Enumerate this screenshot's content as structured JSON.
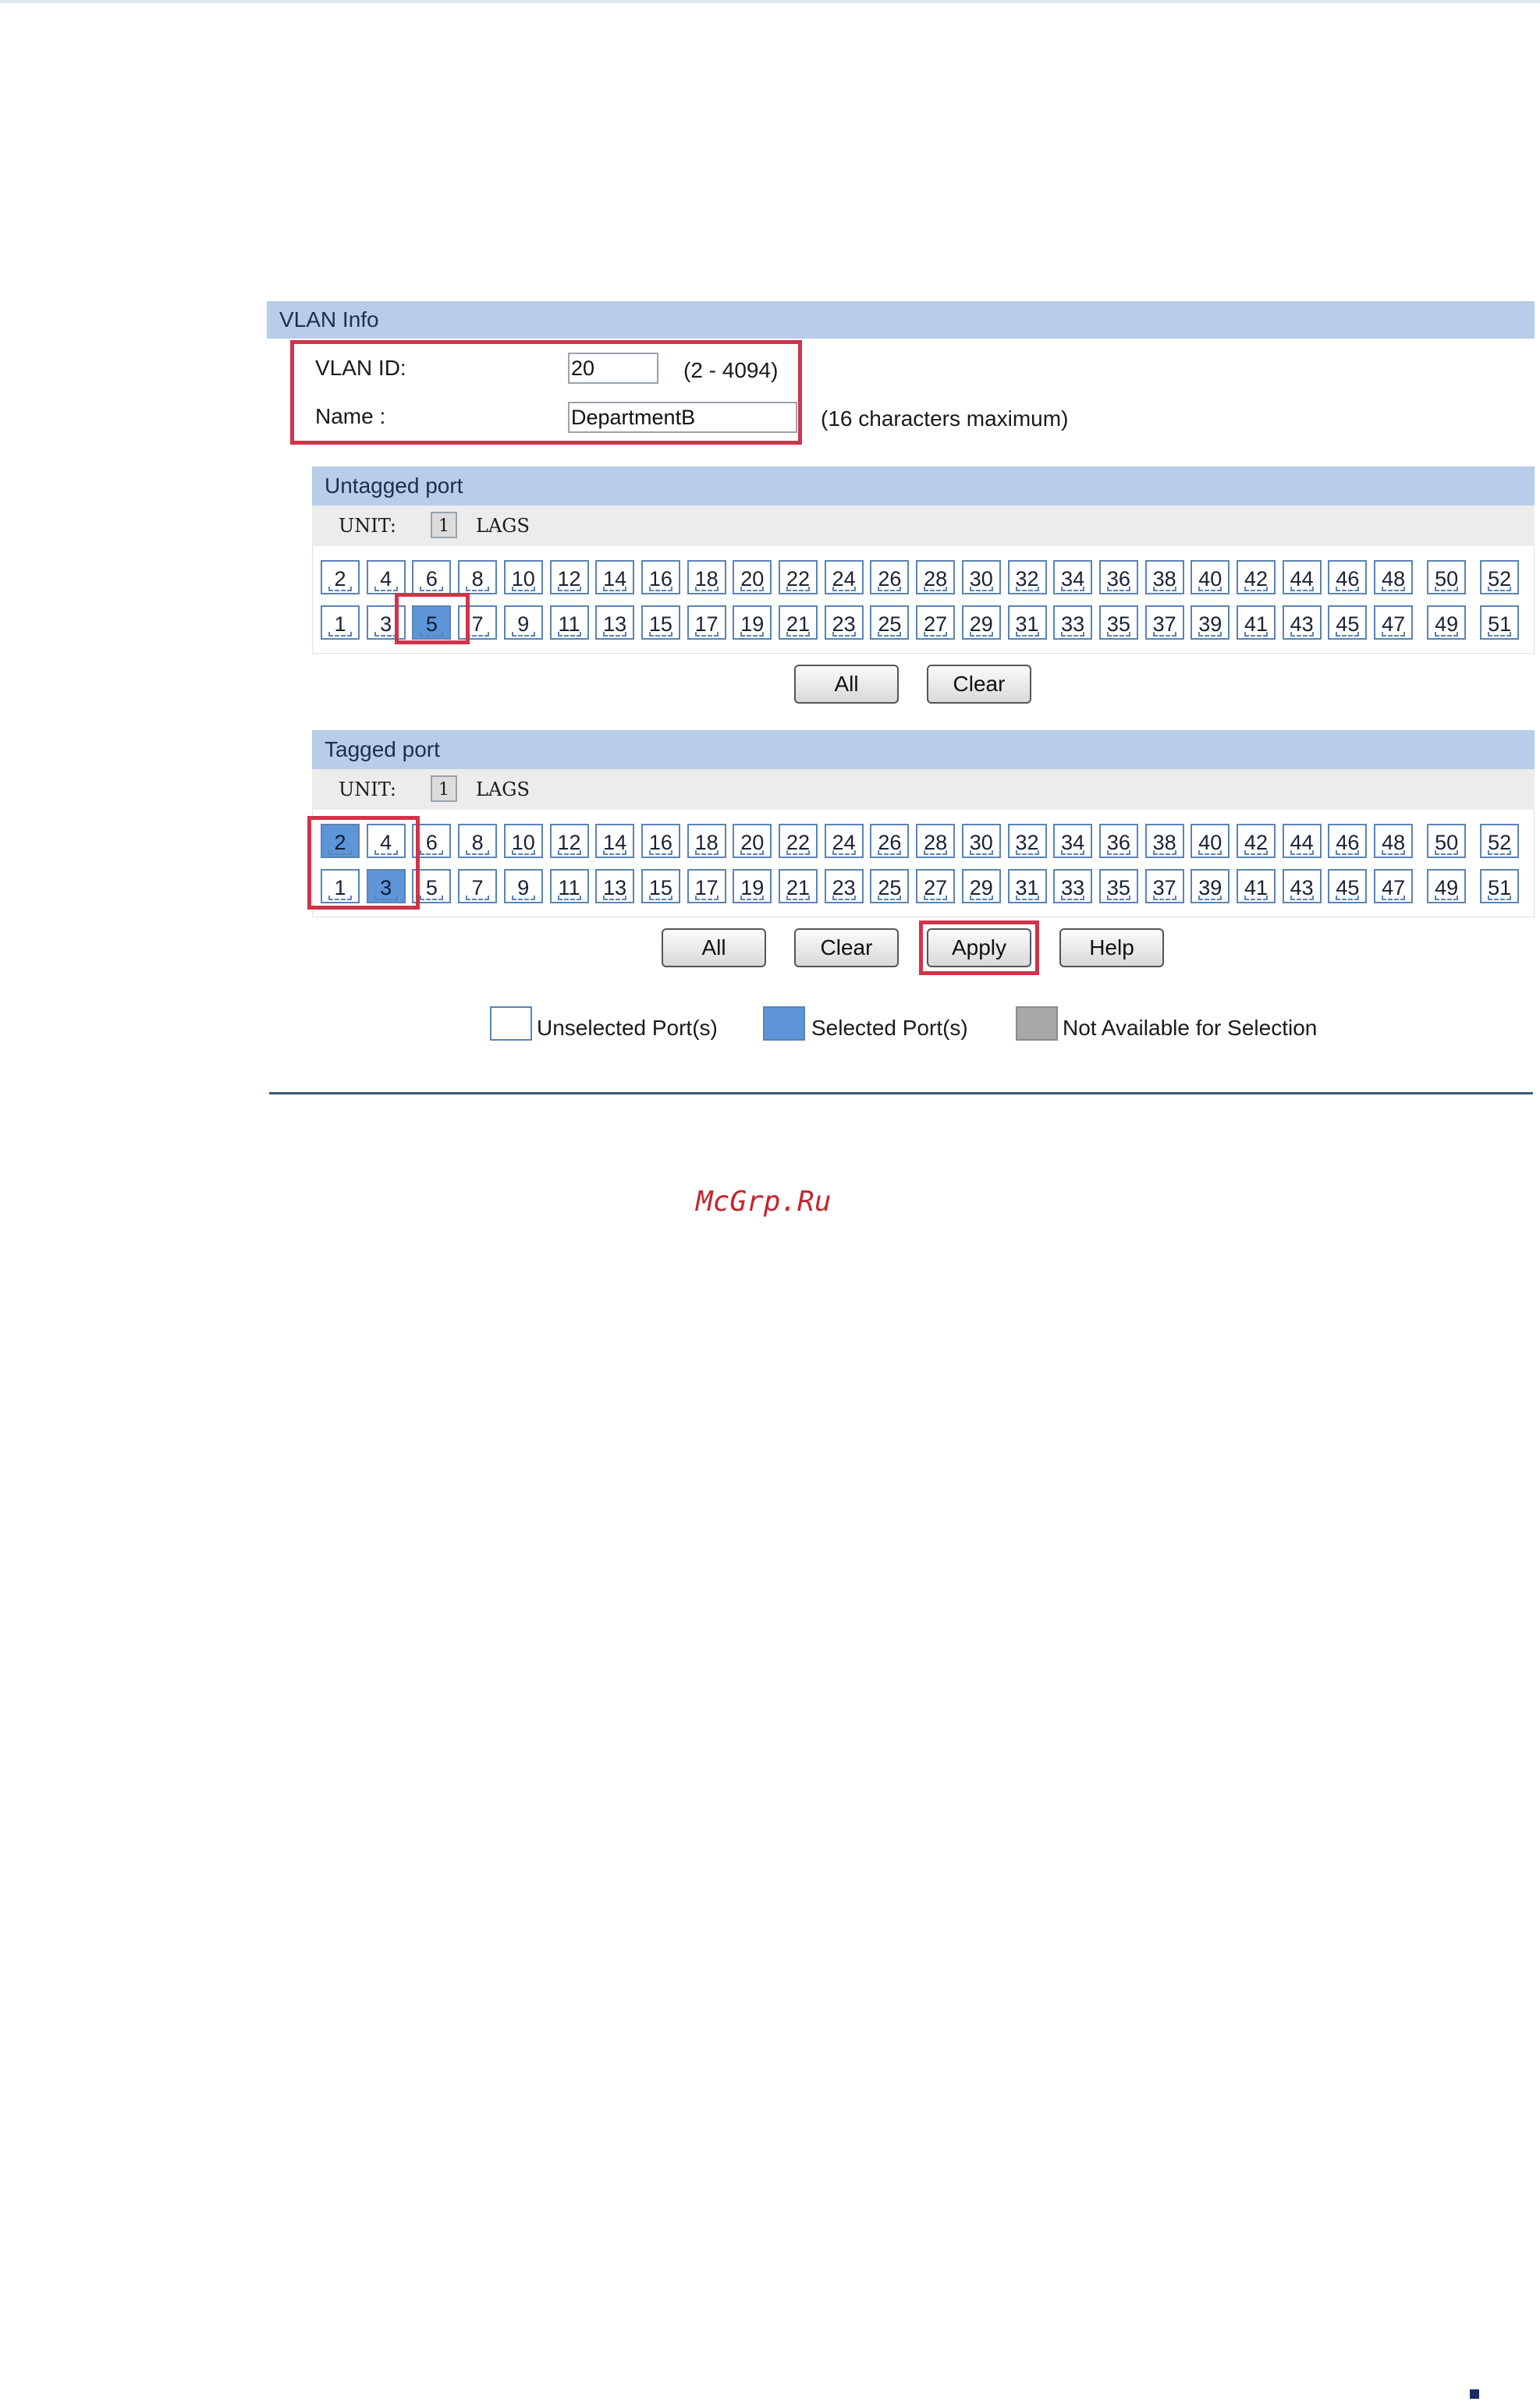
{
  "vlan_info": {
    "header": "VLAN Info",
    "vlan_id_label": "VLAN ID:",
    "vlan_id_value": "20",
    "vlan_id_hint": "(2 - 4094)",
    "name_label": "Name :",
    "name_value": "DepartmentB",
    "name_hint": "(16 characters maximum)"
  },
  "untagged": {
    "header": "Untagged port",
    "unit_label": "UNIT:",
    "unit_value": "1",
    "lags_label": "LAGS",
    "top_row": [
      "2",
      "4",
      "6",
      "8",
      "10",
      "12",
      "14",
      "16",
      "18",
      "20",
      "22",
      "24",
      "26",
      "28",
      "30",
      "32",
      "34",
      "36",
      "38",
      "40",
      "42",
      "44",
      "46",
      "48",
      "50",
      "52"
    ],
    "bottom_row": [
      "1",
      "3",
      "5",
      "7",
      "9",
      "11",
      "13",
      "15",
      "17",
      "19",
      "21",
      "23",
      "25",
      "27",
      "29",
      "31",
      "33",
      "35",
      "37",
      "39",
      "41",
      "43",
      "45",
      "47",
      "49",
      "51"
    ],
    "selected": [
      "5"
    ],
    "all_label": "All",
    "clear_label": "Clear"
  },
  "tagged": {
    "header": "Tagged port",
    "unit_label": "UNIT:",
    "unit_value": "1",
    "lags_label": "LAGS",
    "top_row": [
      "2",
      "4",
      "6",
      "8",
      "10",
      "12",
      "14",
      "16",
      "18",
      "20",
      "22",
      "24",
      "26",
      "28",
      "30",
      "32",
      "34",
      "36",
      "38",
      "40",
      "42",
      "44",
      "46",
      "48",
      "50",
      "52"
    ],
    "bottom_row": [
      "1",
      "3",
      "5",
      "7",
      "9",
      "11",
      "13",
      "15",
      "17",
      "19",
      "21",
      "23",
      "25",
      "27",
      "29",
      "31",
      "33",
      "35",
      "37",
      "39",
      "41",
      "43",
      "45",
      "47",
      "49",
      "51"
    ],
    "selected": [
      "2",
      "3"
    ],
    "all_label": "All",
    "clear_label": "Clear",
    "apply_label": "Apply",
    "help_label": "Help"
  },
  "legend": {
    "unselected": "Unselected Port(s)",
    "selected": "Selected Port(s)",
    "not_available": "Not Available for Selection"
  },
  "watermark": "McGrp.Ru",
  "colors": {
    "header_band": "#b7cdea",
    "port_border": "#5a84b6",
    "port_selected": "#5e95d8",
    "port_unavailable": "#a8a8a8",
    "highlight": "#d1334a"
  }
}
